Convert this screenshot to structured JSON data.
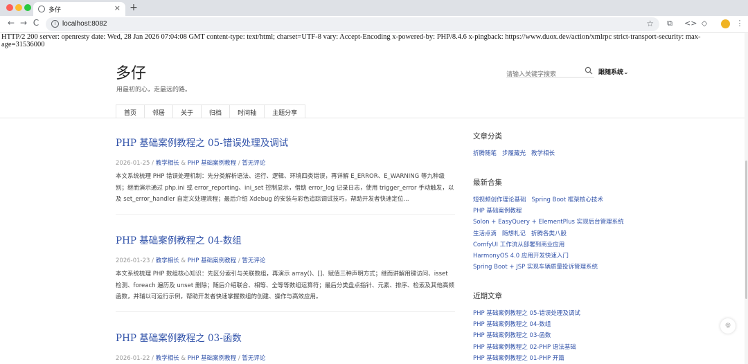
{
  "browser": {
    "tab_title": "多仔",
    "tab_close": "×",
    "new_tab": "+",
    "back": "←",
    "forward": "→",
    "reload": "C",
    "url": "localhost:8082",
    "star": "☆",
    "ext_icon": "⧉",
    "code_icon": "<>",
    "bookmark_icon": "◇",
    "menu_icon": "⋮",
    "profile_color": "#f0b323"
  },
  "http_headers": "HTTP/2 200 server: openresty date: Wed, 28 Jan 2026 07:04:08 GMT content-type: text/html; charset=UTF-8 vary: Accept-Encoding x-powered-by: PHP/8.4.6 x-pingback: https://www.duox.dev/action/xmlrpc strict-transport-security: max-age=31536000",
  "site": {
    "title": "多仔",
    "description": "用最初的心，走最远的路。",
    "search_placeholder": "请输入关键字搜索",
    "theme_select": "跟随系统",
    "theme_chevron": "⌄",
    "nav": [
      "首页",
      "邻居",
      "关于",
      "归档",
      "时间轴",
      "主题分享"
    ]
  },
  "posts": [
    {
      "title": "PHP 基础案例教程之 05-错误处理及调试",
      "date": "2026-01-25",
      "sep1": "/",
      "cat1": "教学相长",
      "amp": "&",
      "cat2": "PHP 基础案例教程",
      "sep2": "/",
      "comments": "暂无评论",
      "excerpt": "本文系统梳理 PHP 错误处理机制：先分类解析语法、运行、逻辑、环境四类错误，再详解 E_ERROR、E_WARNING 等九种级别；继而演示通过 php.ini 或 error_reporting、ini_set 控制显示，借助 error_log 记录日志，使用 trigger_error 手动触发，以及 set_error_handler 自定义处理流程；最后介绍 Xdebug 的安装与彩色追踪调试技巧，帮助开发者快速定位..."
    },
    {
      "title": "PHP 基础案例教程之 04-数组",
      "date": "2026-01-23",
      "sep1": "/",
      "cat1": "教学相长",
      "amp": "&",
      "cat2": "PHP 基础案例教程",
      "sep2": "/",
      "comments": "暂无评论",
      "excerpt": "本文系统梳理 PHP 数组核心知识：先区分索引与关联数组，再演示 array()、[]、赋值三种声明方式；继而讲解用键访问、isset 检测、foreach 遍历及 unset 删除；随后介绍联合、相等、全等等数组运算符；最后分类盘点指针、元素、排序、检索及其他高频函数，并辅以可运行示例，帮助开发者快速掌握数组的创建、操作与高效应用。"
    },
    {
      "title": "PHP 基础案例教程之 03-函数",
      "date": "2026-01-22",
      "sep1": "/",
      "cat1": "教学相长",
      "amp": "&",
      "cat2": "PHP 基础案例教程",
      "sep2": "/",
      "comments": "暂无评论",
      "excerpt": ""
    }
  ],
  "sidebar": {
    "categories_title": "文章分类",
    "categories": [
      "折腾随笔",
      "步履藏光",
      "教学相长"
    ],
    "collections_title": "最新合集",
    "collections": [
      [
        "短视频创作理论基础",
        "Spring Boot 框架核心技术"
      ],
      [
        "PHP 基础案例教程"
      ],
      [
        "Solon + EasyQuery + ElementPlus 实现后台管理系统"
      ],
      [
        "生活点滴",
        "随想札记",
        "折腾各类八股"
      ],
      [
        "ComfyUI 工作流从部署到商业应用"
      ],
      [
        "HarmonyOS 4.0 应用开发快速入门"
      ],
      [
        "Spring Boot + JSP 实现车辆质量投诉管理系统"
      ]
    ],
    "recent_title": "近期文章",
    "recent": [
      "PHP 基础案例教程之 05-错误处理及调试",
      "PHP 基础案例教程之 04-数组",
      "PHP 基础案例教程之 03-函数",
      "PHP 基础案例教程之 02-PHP 语法基础",
      "PHP 基础案例教程之 01-PHP 开篇"
    ]
  },
  "float_button_icon": "☼"
}
